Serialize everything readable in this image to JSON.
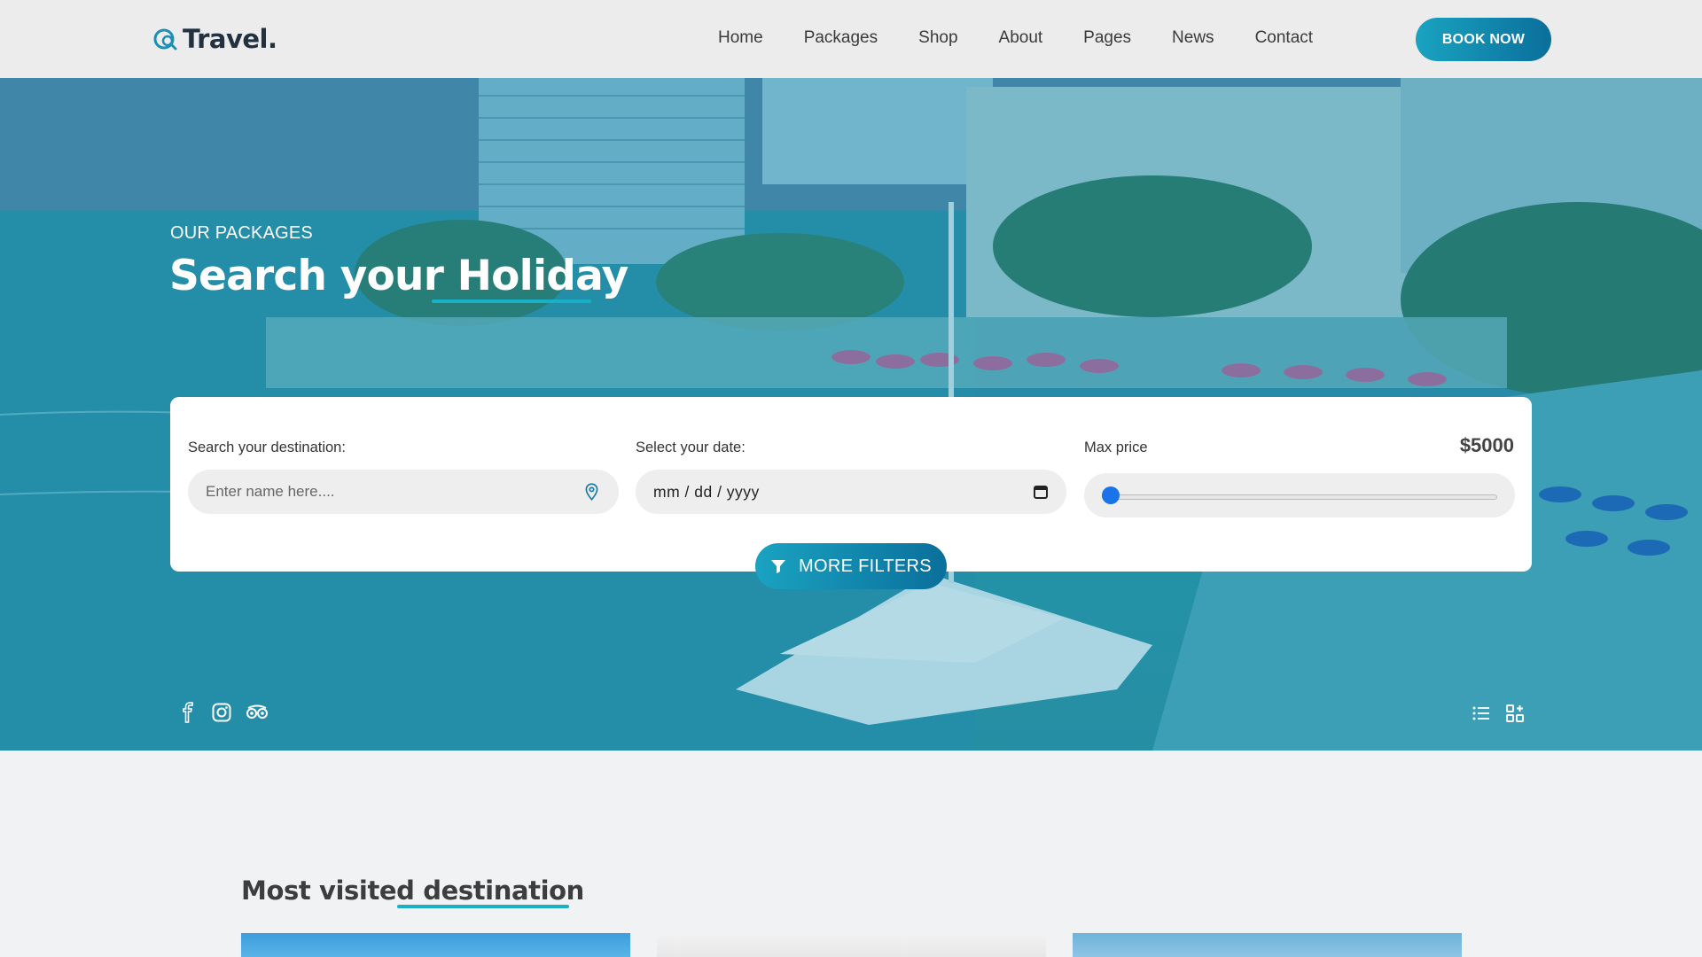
{
  "brand": {
    "logo_text": "Travel."
  },
  "nav": {
    "items": [
      "Home",
      "Packages",
      "Shop",
      "About",
      "Pages",
      "News",
      "Contact"
    ],
    "cta": "BOOK NOW"
  },
  "hero": {
    "kicker": "OUR PACKAGES",
    "title": "Search your Holiday"
  },
  "search": {
    "destination_label": "Search your destination:",
    "destination_placeholder": "Enter name here....",
    "date_label": "Select your date:",
    "date_value": "mm / dd / yyyy",
    "price_label": "Max price",
    "price_value": "$5000",
    "slider_level": 0,
    "more_filters": "MORE FILTERS"
  },
  "social_icons": [
    "facebook-icon",
    "instagram-icon",
    "tripadvisor-icon"
  ],
  "view_icons": [
    "list-view-icon",
    "grid-view-icon"
  ],
  "section": {
    "title": "Most visited destination"
  },
  "colors": {
    "accent": "#17b0c7",
    "button_start": "#1aa3c1",
    "button_end": "#0a6f9b"
  }
}
